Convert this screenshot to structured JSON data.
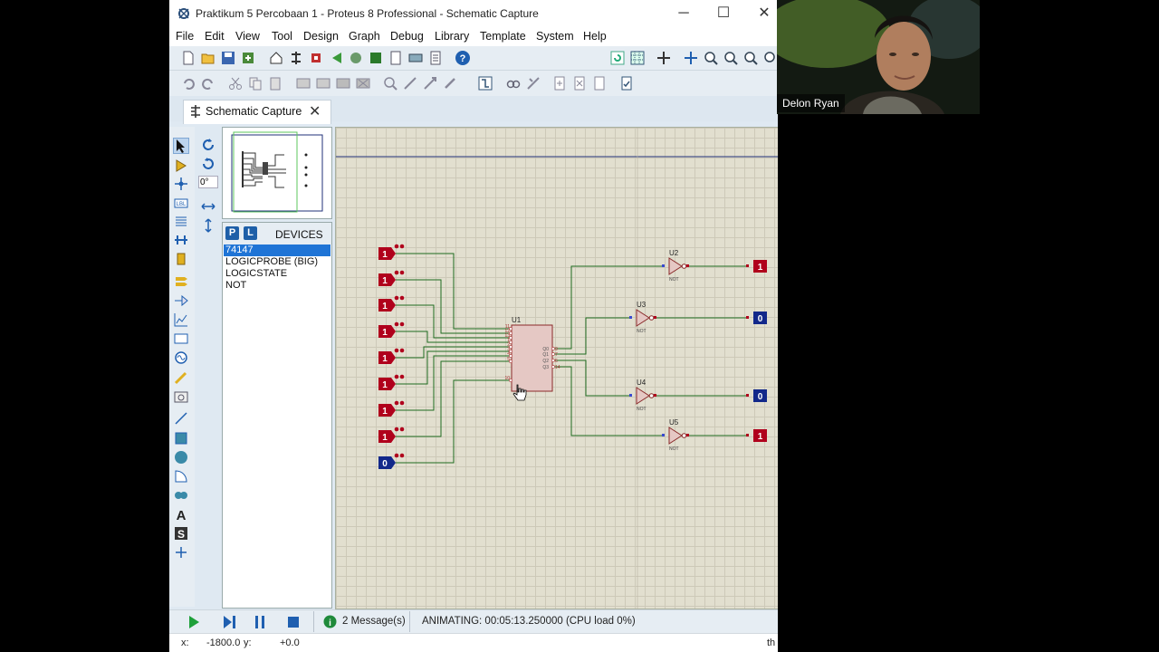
{
  "window": {
    "title": "Praktikum 5 Percobaan 1 - Proteus 8 Professional - Schematic Capture",
    "minimize": "─",
    "maximize": "☐",
    "close": "✕"
  },
  "menu": [
    "File",
    "Edit",
    "View",
    "Tool",
    "Design",
    "Graph",
    "Debug",
    "Library",
    "Template",
    "System",
    "Help"
  ],
  "tab": {
    "label": "Schematic Capture",
    "close": "✕"
  },
  "rotation": {
    "value": "0°"
  },
  "devices": {
    "P": "P",
    "L": "L",
    "header": "DEVICES",
    "items": [
      "74147",
      "LOGICPROBE (BIG)",
      "LOGICSTATE",
      "NOT"
    ],
    "selected_index": 0
  },
  "schematic": {
    "inputs": [
      "1",
      "1",
      "1",
      "1",
      "1",
      "1",
      "1",
      "1",
      "0"
    ],
    "ic": {
      "ref": "U1",
      "left_pins": [
        "11",
        "12",
        "13",
        "1",
        "2",
        "3",
        "4",
        "5",
        "10"
      ],
      "right_pins": [
        "9",
        "7",
        "6",
        "14"
      ],
      "outputs": [
        "Q0",
        "Q1",
        "Q2",
        "Q3"
      ]
    },
    "gates": [
      {
        "ref": "U2",
        "type": "NOT"
      },
      {
        "ref": "U3",
        "type": "NOT"
      },
      {
        "ref": "U4",
        "type": "NOT"
      },
      {
        "ref": "U5",
        "type": "NOT"
      }
    ],
    "probes": [
      "1",
      "0",
      "0",
      "1"
    ],
    "colors": {
      "high": "#b0001c",
      "low": "#12288a",
      "wire": "#1f6b1f",
      "body": "#e5c8c4"
    }
  },
  "status": {
    "messages": "2 Message(s)",
    "animating": "ANIMATING: 00:05:13.250000 (CPU load 0%)"
  },
  "coords": {
    "x_label": "x:",
    "x_value": "-1800.0",
    "y_label": "y:",
    "y_value": "+0.0",
    "right_text": "th"
  },
  "webcam": {
    "name": "Delon Ryan"
  }
}
